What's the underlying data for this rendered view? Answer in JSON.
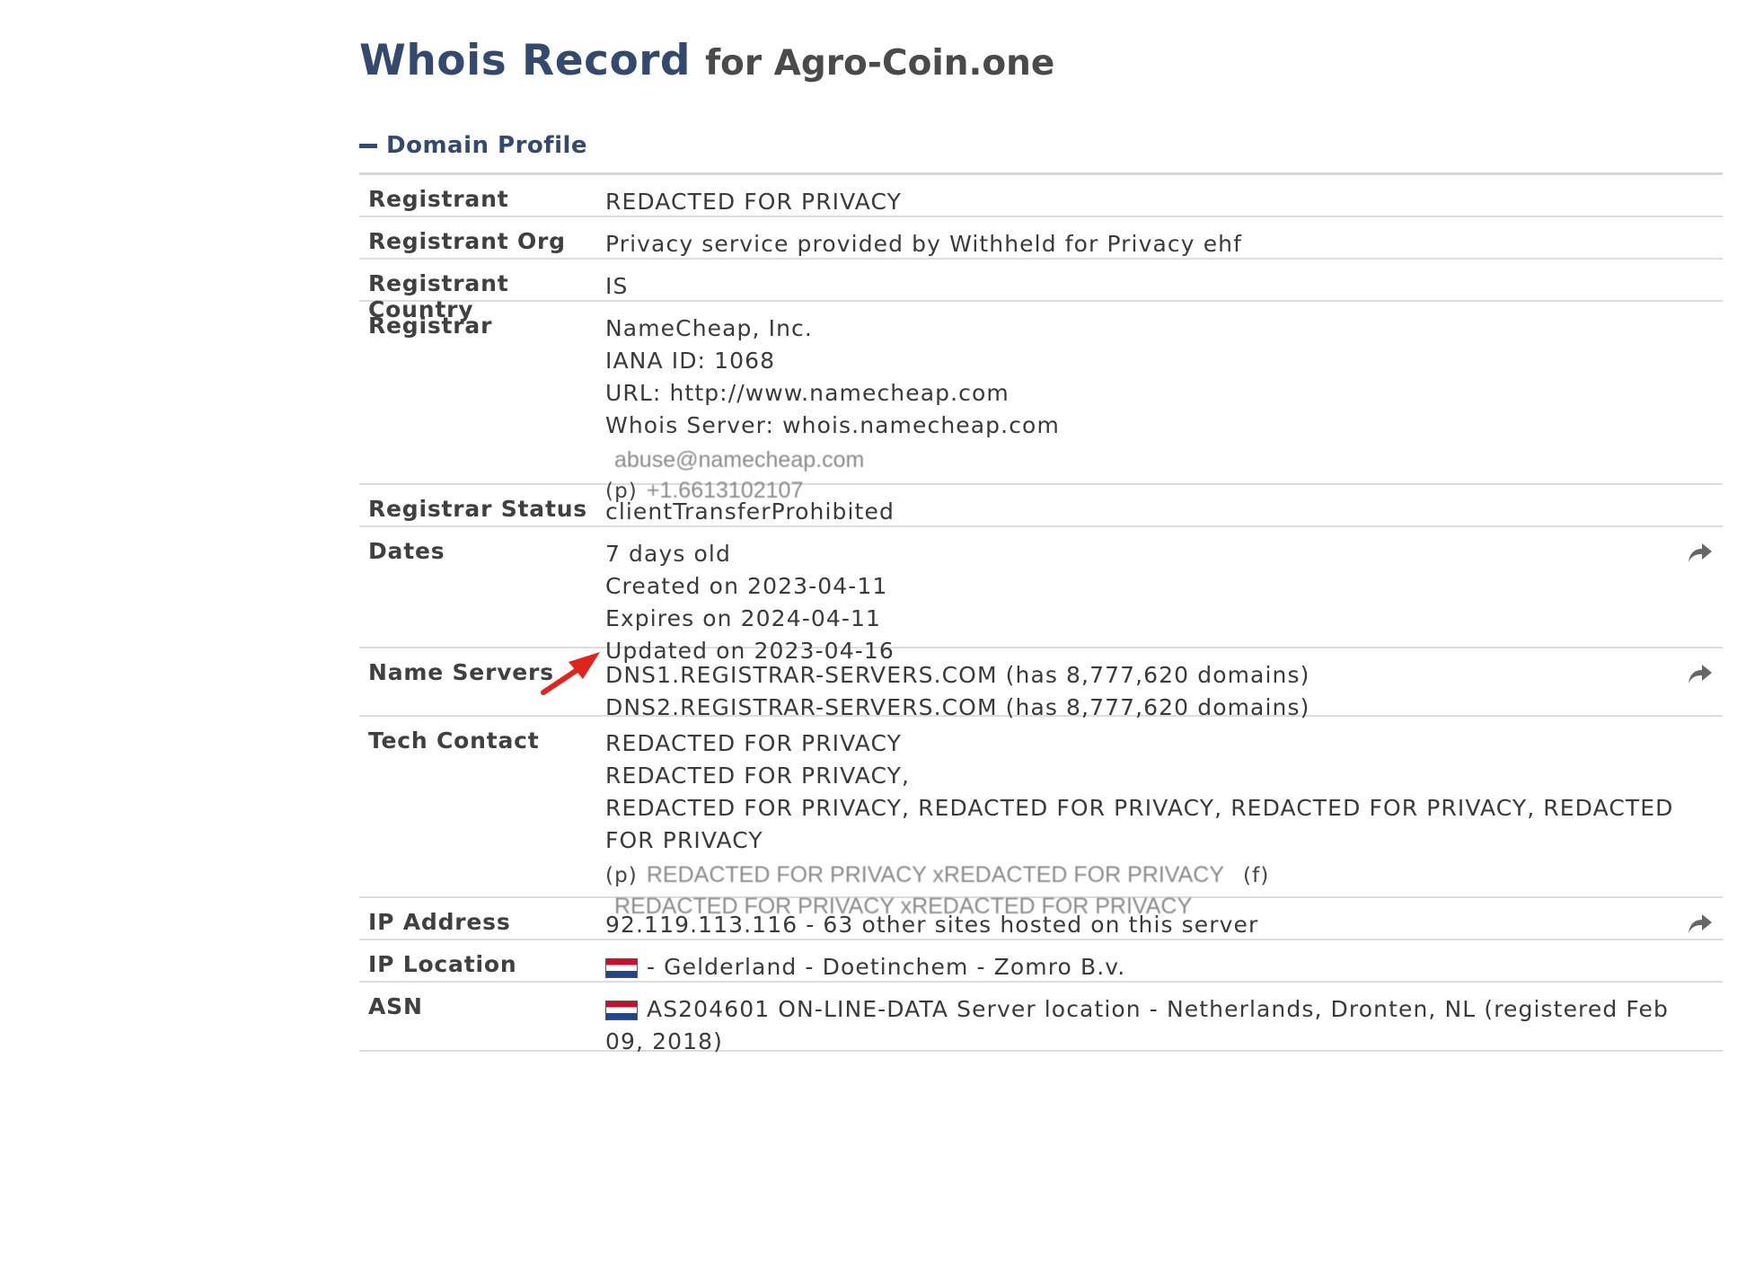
{
  "header": {
    "title_main": "Whois Record",
    "title_for": "for Agro-Coin.one"
  },
  "section": {
    "label": "Domain Profile",
    "toggle_icon": "minus-icon"
  },
  "rows": {
    "registrant": {
      "key": "Registrant",
      "value": "REDACTED FOR PRIVACY"
    },
    "registrant_org": {
      "key": "Registrant Org",
      "value": "Privacy service provided by Withheld for Privacy ehf"
    },
    "registrant_country": {
      "key": "Registrant Country",
      "value": "IS"
    },
    "registrar": {
      "key": "Registrar",
      "lines": [
        "NameCheap, Inc.",
        "IANA ID: 1068",
        "URL: http://www.namecheap.com",
        "Whois Server: whois.namecheap.com"
      ],
      "email": "abuse@namecheap.com",
      "phone_prefix": "(p)",
      "phone": "+1.6613102107"
    },
    "registrar_status": {
      "key": "Registrar Status",
      "value": "clientTransferProhibited"
    },
    "dates": {
      "key": "Dates",
      "lines": [
        "7 days old",
        "Created on 2023-04-11",
        "Expires on 2024-04-11",
        "Updated on 2023-04-16"
      ]
    },
    "name_servers": {
      "key": "Name Servers",
      "lines": [
        "DNS1.REGISTRAR-SERVERS.COM (has 8,777,620 domains)",
        "DNS2.REGISTRAR-SERVERS.COM (has 8,777,620 domains)"
      ]
    },
    "tech_contact": {
      "key": "Tech Contact",
      "line1": "REDACTED FOR PRIVACY",
      "line2": "REDACTED FOR PRIVACY,",
      "line3": "REDACTED FOR PRIVACY, REDACTED FOR PRIVACY, REDACTED FOR PRIVACY, REDACTED FOR PRIVACY",
      "phone_prefix": "(p)",
      "phone": "REDACTED FOR PRIVACY xREDACTED FOR PRIVACY",
      "fax_prefix": "(f)",
      "email": "REDACTED FOR PRIVACY xREDACTED FOR PRIVACY"
    },
    "ip_address": {
      "key": "IP Address",
      "value": "92.119.113.116 - 63 other sites hosted on this server"
    },
    "ip_location": {
      "key": "IP Location",
      "value": "- Gelderland - Doetinchem - Zomro B.v."
    },
    "asn": {
      "key": "ASN",
      "value": "AS204601 ON-LINE-DATA Server location - Netherlands, Dronten, NL (registered Feb 09, 2018)"
    }
  },
  "icons": {
    "share": "share-icon",
    "flag": "netherlands-flag-icon",
    "annotation": "red-arrow-annotation"
  },
  "colors": {
    "title": "#33496d",
    "arrow": "#e0241b",
    "rule": "#dddddd"
  }
}
